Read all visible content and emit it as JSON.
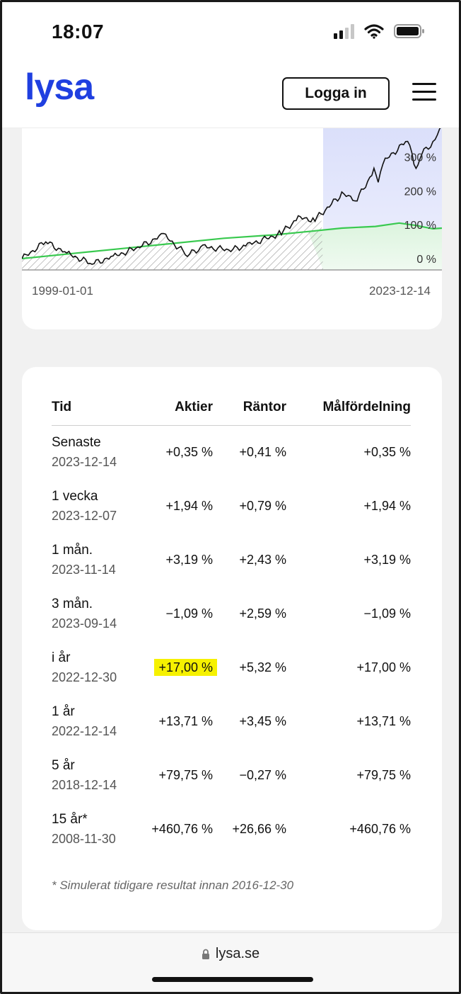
{
  "status_bar": {
    "time": "18:07",
    "icons": [
      "cellular-signal-icon",
      "wifi-icon",
      "battery-icon"
    ]
  },
  "header": {
    "logo": "lysa",
    "login_label": "Logga in",
    "menu_icon": "hamburger-menu-icon"
  },
  "chart": {
    "start_date": "1999-01-01",
    "end_date": "2023-12-14",
    "y_ticks": [
      "300 %",
      "200 %",
      "100 %",
      "0 %"
    ]
  },
  "chart_data": {
    "type": "line",
    "xlabel": "",
    "ylabel": "",
    "x_range": [
      "1999-01-01",
      "2023-12-14"
    ],
    "ylim": [
      -20,
      400
    ],
    "y_tick_values": [
      0,
      100,
      200,
      300
    ],
    "series": [
      {
        "color": "#111111",
        "x": [
          "1999-01-01",
          "2000-06-01",
          "2001-09-01",
          "2003-03-01",
          "2004-06-01",
          "2006-01-01",
          "2007-06-01",
          "2008-11-01",
          "2009-10-01",
          "2011-06-01",
          "2012-06-01",
          "2014-06-01",
          "2015-06-01",
          "2016-06-01",
          "2018-01-01",
          "2018-12-01",
          "2019-12-01",
          "2020-03-01",
          "2020-08-01",
          "2021-12-01",
          "2022-06-01",
          "2022-10-01",
          "2023-06-01",
          "2023-12-14"
        ],
        "values": [
          0,
          50,
          15,
          -15,
          5,
          35,
          70,
          10,
          35,
          25,
          40,
          75,
          120,
          115,
          190,
          175,
          260,
          230,
          290,
          350,
          260,
          310,
          340,
          390
        ]
      },
      {
        "color": "#39c94f",
        "x": [
          "1999-01-01",
          "2002-01-01",
          "2005-01-01",
          "2008-01-01",
          "2011-01-01",
          "2014-01-01",
          "2016-01-01",
          "2018-01-01",
          "2020-01-01",
          "2021-06-01",
          "2022-06-01",
          "2023-06-01",
          "2023-12-14"
        ],
        "values": [
          0,
          15,
          30,
          45,
          60,
          70,
          80,
          90,
          95,
          105,
          98,
          88,
          90
        ]
      }
    ]
  },
  "table": {
    "headers": {
      "period": "Tid",
      "stocks": "Aktier",
      "bonds": "Räntor",
      "target": "Målfördelning"
    },
    "rows": [
      {
        "label": "Senaste",
        "date": "2023-12-14",
        "stocks": "+0,35 %",
        "bonds": "+0,41 %",
        "target": "+0,35 %"
      },
      {
        "label": "1 vecka",
        "date": "2023-12-07",
        "stocks": "+1,94 %",
        "bonds": "+0,79 %",
        "target": "+1,94 %"
      },
      {
        "label": "1 mån.",
        "date": "2023-11-14",
        "stocks": "+3,19 %",
        "bonds": "+2,43 %",
        "target": "+3,19 %"
      },
      {
        "label": "3 mån.",
        "date": "2023-09-14",
        "stocks": "−1,09 %",
        "bonds": "+2,59 %",
        "target": "−1,09 %"
      },
      {
        "label": "i år",
        "date": "2022-12-30",
        "stocks": "+17,00 %",
        "bonds": "+5,32 %",
        "target": "+17,00 %",
        "highlighted": true
      },
      {
        "label": "1 år",
        "date": "2022-12-14",
        "stocks": "+13,71 %",
        "bonds": "+3,45 %",
        "target": "+13,71 %"
      },
      {
        "label": "5 år",
        "date": "2018-12-14",
        "stocks": "+79,75 %",
        "bonds": "−0,27 %",
        "target": "+79,75 %"
      },
      {
        "label": "15 år*",
        "date": "2008-11-30",
        "stocks": "+460,76 %",
        "bonds": "+26,66 %",
        "target": "+460,76 %"
      }
    ],
    "footnote": "* Simulerat tidigare resultat innan 2016-12-30",
    "highlight_color": "#f6f100"
  },
  "browser": {
    "url": "lysa.se"
  },
  "colors": {
    "brand": "#1f3fe0",
    "stock_line": "#111111",
    "bond_line": "#39c94f",
    "forecast_blue": "#dfe3fb",
    "forecast_green": "#e2f6e3"
  }
}
